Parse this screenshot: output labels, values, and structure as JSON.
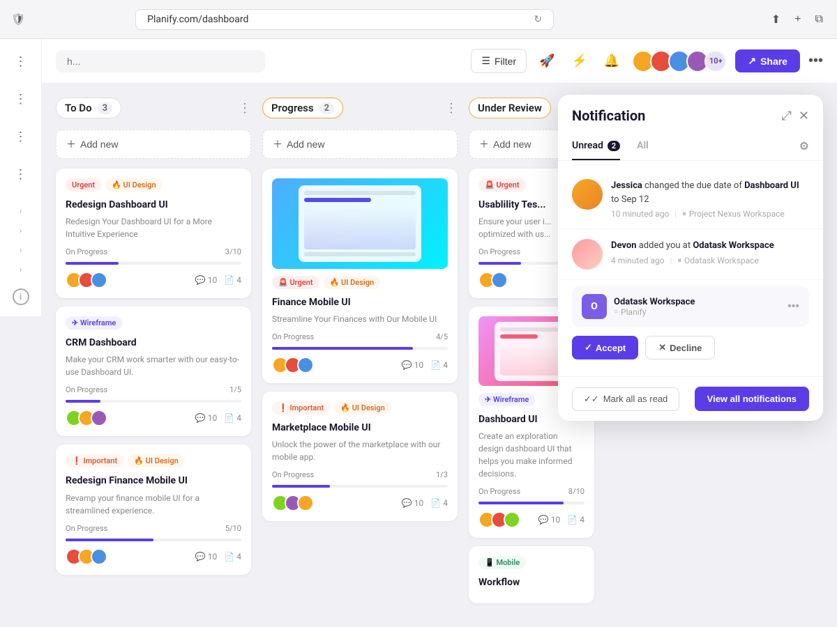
{
  "browser": {
    "url": "Planify.com/dashboard",
    "shield_icon": "🛡",
    "reload_icon": "↻"
  },
  "toolbar": {
    "search_placeholder": "h...",
    "filter_label": "Filter",
    "share_label": "Share",
    "more_icon": "•••",
    "unread_count": "10+"
  },
  "sidebar": {
    "items": [
      "•••",
      "•••",
      "•••",
      "•••"
    ]
  },
  "columns": [
    {
      "title": "To Do",
      "count": "3",
      "add_new": "Add new",
      "cards": [
        {
          "tags": [
            "Urgent",
            "UI Design"
          ],
          "tag_types": [
            "urgent",
            "ui-design"
          ],
          "title": "Redesign Dashboard UI",
          "desc": "Redesign Your Dashboard UI for a More Intuitive Experience",
          "progress_label": "On Progress",
          "progress_val": "3/10",
          "progress_pct": 30,
          "comments": "10",
          "files": "4",
          "has_thumb": false
        },
        {
          "tags": [
            "Wireframe"
          ],
          "tag_types": [
            "wireframe"
          ],
          "title": "CRM Dashboard",
          "desc": "Make your CRM work smarter with our easy-to-use Dashboard UI.",
          "progress_label": "On Progress",
          "progress_val": "1/5",
          "progress_pct": 20,
          "comments": "10",
          "files": "4",
          "has_thumb": false
        },
        {
          "tags": [
            "Important",
            "UI Design"
          ],
          "tag_types": [
            "important",
            "ui-design"
          ],
          "title": "Redesign Finance Mobile UI",
          "desc": "Revamp your finance mobile UI for a streamlined experience.",
          "progress_label": "On Progress",
          "progress_val": "5/10",
          "progress_pct": 50,
          "comments": "10",
          "files": "4",
          "has_thumb": false
        }
      ]
    },
    {
      "title": "Progress",
      "count": "2",
      "add_new": "Add new",
      "cards": [
        {
          "tags": [
            "Urgent",
            "UI Design"
          ],
          "tag_types": [
            "urgent",
            "ui-design"
          ],
          "title": "Finance Mobile UI",
          "desc": "Streamline Your Finances with Our Mobile UI",
          "progress_label": "On Progress",
          "progress_val": "4/5",
          "progress_pct": 80,
          "comments": "10",
          "files": "4",
          "has_thumb": true
        },
        {
          "tags": [
            "Important",
            "UI Design"
          ],
          "tag_types": [
            "important",
            "ui-design"
          ],
          "title": "Marketplace Mobile UI",
          "desc": "Unlock the power of the marketplace with our mobile app.",
          "progress_label": "On Progress",
          "progress_val": "1/3",
          "progress_pct": 33,
          "comments": "10",
          "files": "4",
          "has_thumb": false
        }
      ]
    },
    {
      "title": "Under Review",
      "count": "",
      "add_new": "Add new",
      "cards": [
        {
          "tags": [
            "Urgent"
          ],
          "tag_types": [
            "urgent"
          ],
          "title": "Usablility Tes...",
          "desc": "Ensure your user i... optimized with us...",
          "progress_label": "On Progress",
          "progress_val": "",
          "progress_pct": 40,
          "comments": "",
          "files": "",
          "has_thumb": false
        },
        {
          "tags": [
            "Wireframe"
          ],
          "tag_types": [
            "wireframe"
          ],
          "title": "Dashboard UI",
          "desc": "Create an exploration design dashboard UI that helps you make informed decisions.",
          "progress_label": "On Progress",
          "progress_val": "8/10",
          "progress_pct": 80,
          "comments": "10",
          "files": "4",
          "has_thumb": true
        },
        {
          "tags": [
            "Mobile"
          ],
          "tag_types": [
            "mobile"
          ],
          "title": "Workflow",
          "desc": "",
          "progress_label": "",
          "progress_val": "",
          "progress_pct": 0,
          "comments": "",
          "files": "",
          "has_thumb": false
        }
      ]
    }
  ],
  "notification": {
    "title": "Notification",
    "tabs": {
      "unread": "Unread",
      "unread_count": "2",
      "all": "All"
    },
    "items": [
      {
        "actor": "Jessica",
        "action": "changed the due date of",
        "subject": "Dashboard UI",
        "suffix": "to Sep 12",
        "time": "10 minuted ago",
        "project": "Project Nexus Workspace",
        "has_dot": false
      },
      {
        "actor": "Devon",
        "action": "added you at",
        "subject": "Odatask Workspace",
        "suffix": "",
        "time": "4 minuted ago",
        "project": "Odatask Workspace",
        "has_dot": true
      }
    ],
    "workspace": {
      "icon_letter": "O",
      "name": "Odatask Workspace",
      "sub": "Planify"
    },
    "actions": {
      "accept": "Accept",
      "decline": "Decline"
    },
    "footer": {
      "mark_all_read": "Mark all as read",
      "view_all": "View all notifications"
    }
  }
}
